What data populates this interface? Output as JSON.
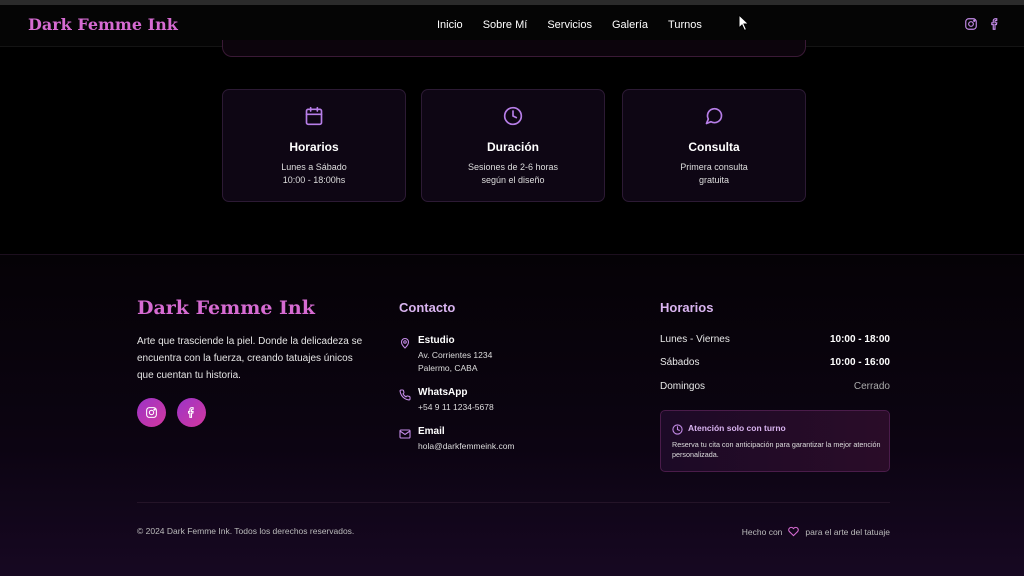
{
  "nav": {
    "brand": "Dark Femme Ink",
    "links": [
      "Inicio",
      "Sobre Mí",
      "Servicios",
      "Galería",
      "Turnos"
    ],
    "social_icons": [
      "instagram-icon",
      "facebook-icon"
    ]
  },
  "info_cards": [
    {
      "icon": "calendar-icon",
      "title": "Horarios",
      "line1": "Lunes a Sábado",
      "line2": "10:00 - 18:00hs"
    },
    {
      "icon": "clock-icon",
      "title": "Duración",
      "line1": "Sesiones de 2-6 horas",
      "line2": "según el diseño"
    },
    {
      "icon": "chat-bubble-icon",
      "title": "Consulta",
      "line1": "Primera consulta",
      "line2": "gratuita"
    }
  ],
  "footer": {
    "brand": "Dark Femme Ink",
    "description": "Arte que trasciende la piel. Donde la delicadeza se encuentra con la fuerza, creando tatuajes únicos que cuentan tu historia.",
    "contact": {
      "title": "Contacto",
      "studio_label": "Estudio",
      "studio_line1": "Av. Corrientes 1234",
      "studio_line2": "Palermo, CABA",
      "whatsapp_label": "WhatsApp",
      "whatsapp_value": "+54 9 11 1234-5678",
      "email_label": "Email",
      "email_value": "hola@darkfemmeink.com"
    },
    "hours": {
      "title": "Horarios",
      "rows": [
        {
          "day": "Lunes - Viernes",
          "time": "10:00 - 18:00"
        },
        {
          "day": "Sábados",
          "time": "10:00 - 16:00"
        },
        {
          "day": "Domingos",
          "time": "Cerrado"
        }
      ],
      "notice_title": "Atención solo con turno",
      "notice_body": "Reserva tu cita con anticipación para garantizar la mejor atención personalizada."
    },
    "copyright": "© 2024 Dark Femme Ink. Todos los derechos reservados.",
    "made_with_prefix": "Hecho con",
    "made_with_suffix": "para el arte del tatuaje"
  },
  "colors": {
    "accent": "#d66bd2",
    "accent_light": "#d9b4f0",
    "icon_purple": "#b77ee8",
    "social_gradient_start": "#9b34c8",
    "social_gradient_end": "#d4379e"
  }
}
